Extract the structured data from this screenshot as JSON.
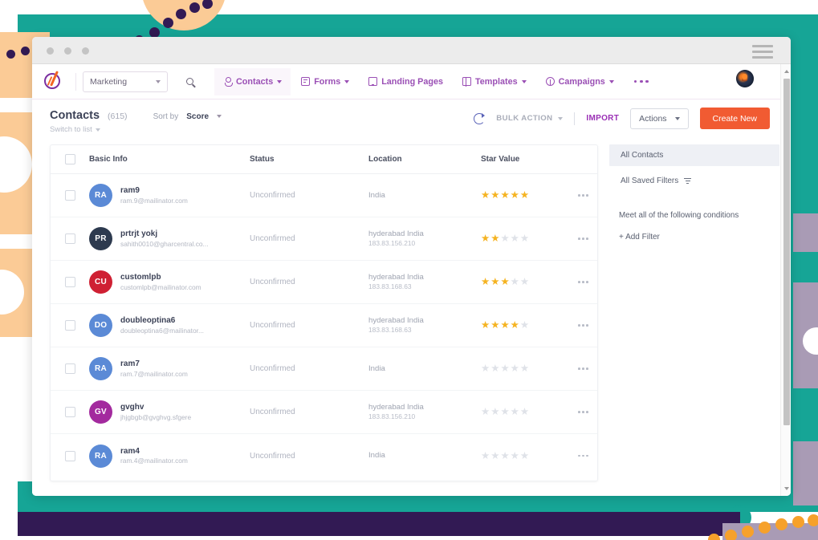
{
  "browser": {
    "traffic_dots": 3,
    "menu_icon": "hamburger-icon"
  },
  "appnav": {
    "logo_icon": "brand-logo-icon",
    "workspace": {
      "label": "Marketing",
      "caret_icon": "chevron-down-icon"
    },
    "search_icon": "search-icon",
    "items": [
      {
        "label": "Contacts",
        "icon": "person-icon",
        "caret": true,
        "active": true
      },
      {
        "label": "Forms",
        "icon": "form-icon",
        "caret": true,
        "active": false
      },
      {
        "label": "Landing Pages",
        "icon": "screen-icon",
        "caret": false,
        "active": false
      },
      {
        "label": "Templates",
        "icon": "template-icon",
        "caret": true,
        "active": false
      },
      {
        "label": "Campaigns",
        "icon": "campaign-icon",
        "caret": true,
        "active": false
      }
    ],
    "overflow_icon": "ellipsis-icon",
    "avatar_icon": "user-avatar"
  },
  "toolbar": {
    "title": "Contacts",
    "count": "(615)",
    "sort_label": "Sort by",
    "sort_value": "Score",
    "switch_view": "Switch to list",
    "refresh_icon": "refresh-icon",
    "bulk_action": "BULK ACTION",
    "import": "IMPORT",
    "actions": "Actions",
    "create_new": "Create New"
  },
  "table": {
    "columns": [
      "Basic Info",
      "Status",
      "Location",
      "Star Value"
    ],
    "rows": [
      {
        "initials": "RA",
        "color": "#5b8ad6",
        "name": "ram9",
        "email": "ram.9@mailinator.com",
        "status": "Unconfirmed",
        "location": "India",
        "ip": "",
        "stars": 5
      },
      {
        "initials": "PR",
        "color": "#2d3a4f",
        "name": "prtrjt yokj",
        "email": "sahith0010@gharcentral.co...",
        "status": "Unconfirmed",
        "location": "hyderabad India",
        "ip": "183.83.156.210",
        "stars": 2
      },
      {
        "initials": "CU",
        "color": "#cf2033",
        "name": "customlpb",
        "email": "customlpb@mailinator.com",
        "status": "Unconfirmed",
        "location": "hyderabad India",
        "ip": "183.83.168.63",
        "stars": 3
      },
      {
        "initials": "DO",
        "color": "#5b8ad6",
        "name": "doubleoptina6",
        "email": "doubleoptina6@mailinator...",
        "status": "Unconfirmed",
        "location": "hyderabad India",
        "ip": "183.83.168.63",
        "stars": 4
      },
      {
        "initials": "RA",
        "color": "#5b8ad6",
        "name": "ram7",
        "email": "ram.7@mailinator.com",
        "status": "Unconfirmed",
        "location": "India",
        "ip": "",
        "stars": 0
      },
      {
        "initials": "GV",
        "color": "#a32a9e",
        "name": "gvghv",
        "email": "jhjgbgb@gvghvg.sfgere",
        "status": "Unconfirmed",
        "location": "hyderabad India",
        "ip": "183.83.156.210",
        "stars": 0
      },
      {
        "initials": "RA",
        "color": "#5b8ad6",
        "name": "ram4",
        "email": "ram.4@mailinator.com",
        "status": "Unconfirmed",
        "location": "India",
        "ip": "",
        "stars": 0
      }
    ],
    "row_menu_icon": "ellipsis-icon",
    "star_total": 5
  },
  "filter_panel": {
    "all_contacts": "All Contacts",
    "saved_filters": "All Saved Filters",
    "filter_icon": "funnel-icon",
    "conditions_label": "Meet all of the following conditions",
    "add_filter": "+ Add Filter"
  },
  "colors": {
    "brand_purple": "#9a4fb5",
    "accent_orange": "#f15b32",
    "teal": "#16a596",
    "navy": "#321a54",
    "dot_orange": "#f6a12b",
    "lavender": "#a99bb5",
    "peach": "#fbcb96",
    "star_on": "#f5b321",
    "star_off": "#dfe2e8"
  }
}
